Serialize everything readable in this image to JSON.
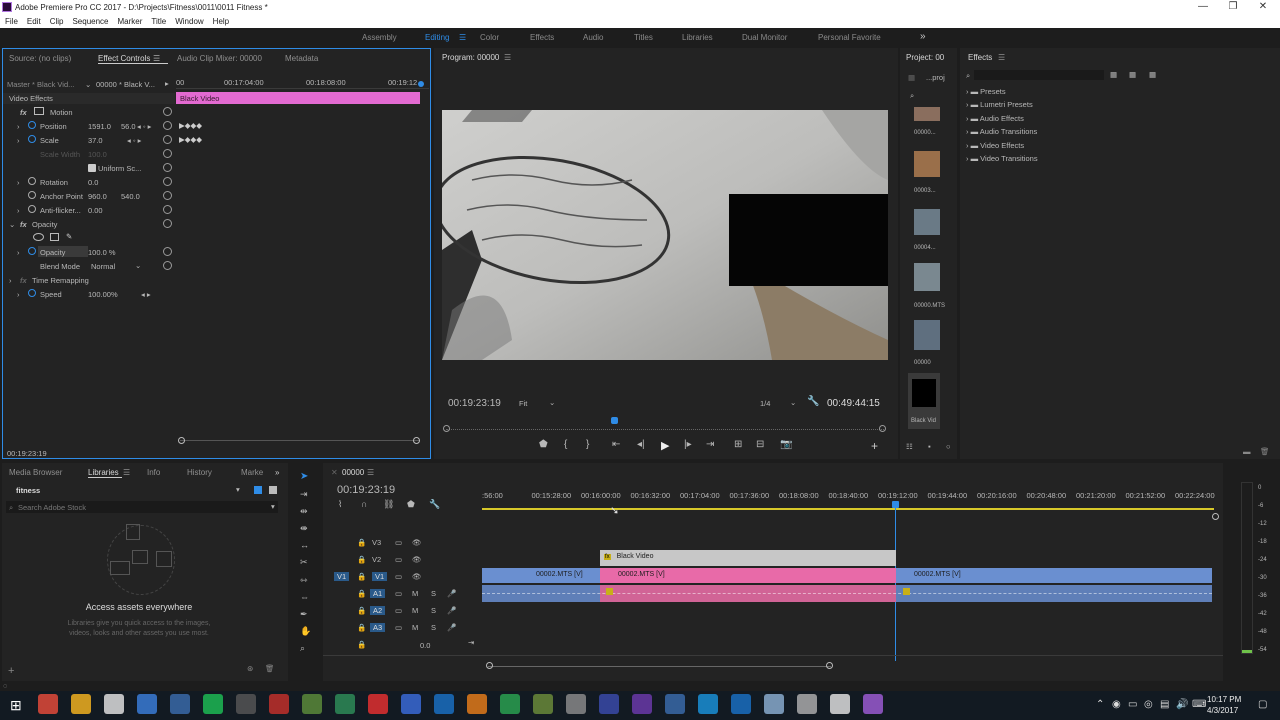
{
  "window": {
    "title": "Adobe Premiere Pro CC 2017 - D:\\Projects\\Fitness\\0011\\0011 Fitness *",
    "min": "—",
    "max": "❐",
    "close": "✕"
  },
  "menu": [
    "File",
    "Edit",
    "Clip",
    "Sequence",
    "Marker",
    "Title",
    "Window",
    "Help"
  ],
  "workspaces": {
    "items": [
      "Assembly",
      "Editing",
      "Color",
      "Effects",
      "Audio",
      "Titles",
      "Libraries",
      "Dual Monitor",
      "Personal Favorite"
    ],
    "active": "Editing",
    "overflow": "»"
  },
  "effect_controls": {
    "tabs": [
      "Source: (no clips)",
      "Effect Controls",
      "Audio Clip Mixer: 00000",
      "Metadata"
    ],
    "active_tab": "Effect Controls",
    "master": "Master * Black Vid...",
    "clip": "00000 * Black V...",
    "ruler": [
      "00",
      "00:17:04:00",
      "00:18:08:00",
      "00:19:12"
    ],
    "clip_bar": "Black Video",
    "section": "Video Effects",
    "motion": "Motion",
    "position_label": "Position",
    "position_x": "1591.0",
    "position_y": "56.0",
    "scale_label": "Scale",
    "scale_value": "37.0",
    "scale_width_label": "Scale Width",
    "scale_width_value": "100.0",
    "uniform": "Uniform Sc...",
    "rotation_label": "Rotation",
    "rotation_value": "0.0",
    "anchor_label": "Anchor Point",
    "anchor_x": "960.0",
    "anchor_y": "540.0",
    "antiflicker_label": "Anti-flicker...",
    "antiflicker_value": "0.00",
    "opacity_section": "Opacity",
    "opacity_label": "Opacity",
    "opacity_value": "100.0 %",
    "blend_label": "Blend Mode",
    "blend_value": "Normal",
    "time_remap": "Time Remapping",
    "speed_label": "Speed",
    "speed_value": "100.00%",
    "timecode": "00:19:23:19"
  },
  "program": {
    "title": "Program: 00000",
    "timecode": "00:19:23:19",
    "fit": "Fit",
    "res": "1/4",
    "duration": "00:49:44:15"
  },
  "project": {
    "title": "Project: 00",
    "file": "...proj",
    "thumbs": [
      "00000...",
      "00003...",
      "00004...",
      "00000.MTS",
      "00000",
      "Black Vid"
    ]
  },
  "effects": {
    "title": "Effects",
    "folders": [
      "Presets",
      "Lumetri Presets",
      "Audio Effects",
      "Audio Transitions",
      "Video Effects",
      "Video Transitions"
    ]
  },
  "libraries": {
    "tabs": [
      "Media Browser",
      "Libraries",
      "Info",
      "History",
      "Marke"
    ],
    "active_tab": "Libraries",
    "library": "fitness",
    "search_placeholder": "Search Adobe Stock",
    "heading": "Access assets everywhere",
    "body": "Libraries give you quick access to the images, videos, looks and other assets you use most."
  },
  "timeline": {
    "tab": "00000",
    "timecode": "00:19:23:19",
    "ruler": [
      ":56:00",
      "00:15:28:00",
      "00:16:00:00",
      "00:16:32:00",
      "00:17:04:00",
      "00:17:36:00",
      "00:18:08:00",
      "00:18:40:00",
      "00:19:12:00",
      "00:19:44:00",
      "00:20:16:00",
      "00:20:48:00",
      "00:21:20:00",
      "00:21:52:00",
      "00:22:24:00",
      "00"
    ],
    "tracks": [
      "V3",
      "V2",
      "V1",
      "A1",
      "A2",
      "A3"
    ],
    "source_v": "V1",
    "master_value": "0.0",
    "clip_black": "Black Video",
    "clip_v1a": "00002.MTS [V]",
    "clip_v1b": "00002.MTS [V]",
    "clip_v1c": "00002.MTS [V]",
    "meter": [
      "0",
      "-6",
      "-12",
      "-18",
      "-24",
      "-30",
      "-36",
      "-42",
      "-48",
      "-54"
    ]
  },
  "taskbar": {
    "time": "10:17 PM",
    "date": "4/3/2017"
  }
}
